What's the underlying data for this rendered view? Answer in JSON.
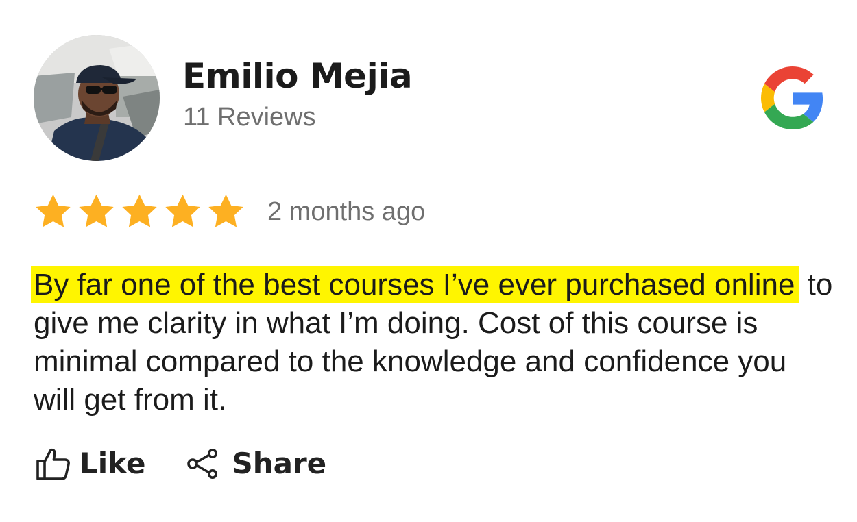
{
  "reviewer": {
    "name": "Emilio Mejia",
    "review_count": "11 Reviews"
  },
  "rating": {
    "stars": 5,
    "max_stars": 5,
    "star_color": "#FDB022"
  },
  "timestamp": "2 months ago",
  "review": {
    "highlighted": "By far one of the best courses I’ve ever purchased online",
    "rest": " to give me clarity in what I’m doing. Cost of this course is minimal compared to the knowledge and confidence you will get from it.",
    "highlight_color": "#FFF500"
  },
  "source_icon": "google-g-icon",
  "actions": {
    "like_label": "Like",
    "share_label": "Share"
  }
}
